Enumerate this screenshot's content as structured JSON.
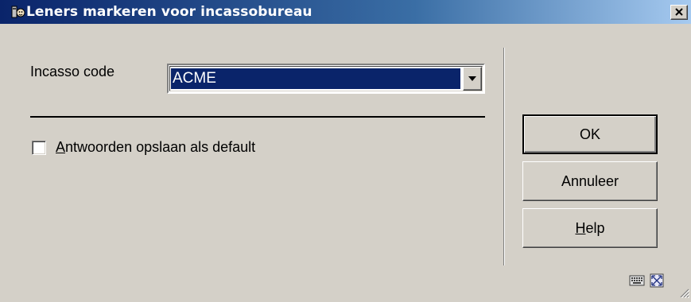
{
  "window": {
    "title": "Leners markeren voor incassobureau",
    "icon": "app-library-icon",
    "close_icon": "close-icon"
  },
  "form": {
    "incasso_label": "Incasso code",
    "incasso_value": "ACME",
    "save_default_label": "Antwoorden opslaan als default",
    "save_default_checked": false
  },
  "buttons": {
    "ok_label": "OK",
    "cancel_label": "Annuleer",
    "help_label": "Help"
  },
  "statusbar": {
    "icons": [
      "keyboard-icon",
      "maximize-icon",
      "resize-grip-icon"
    ]
  }
}
